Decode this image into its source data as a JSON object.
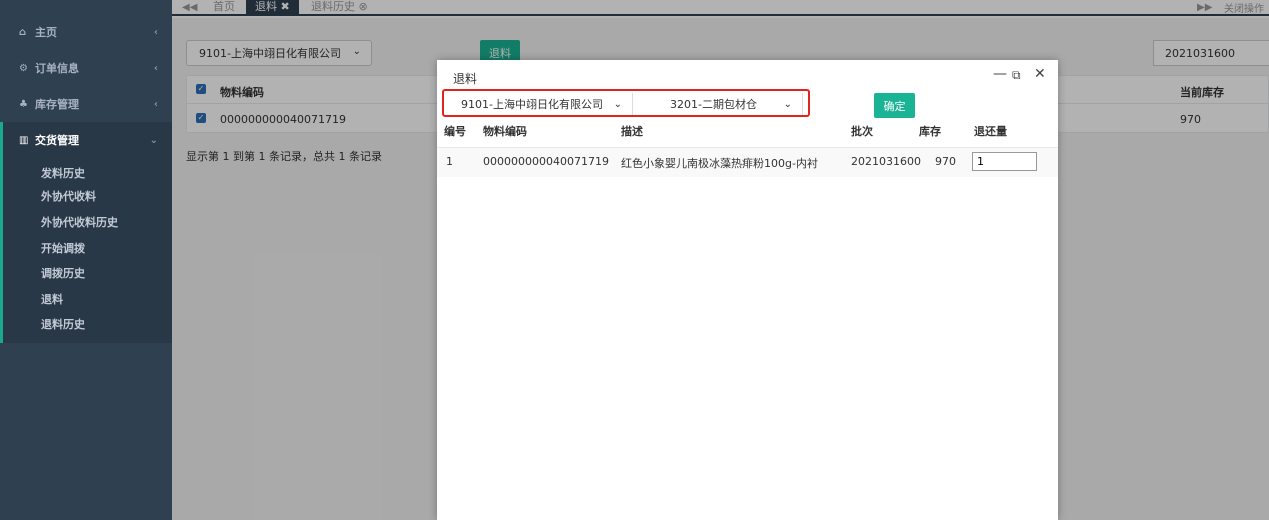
{
  "sidebar": {
    "items": [
      {
        "label": "主页",
        "icon": "home-icon"
      },
      {
        "label": "订单信息",
        "icon": "settings-icon"
      },
      {
        "label": "库存管理",
        "icon": "users-icon"
      },
      {
        "label": "交货管理",
        "icon": "chart-icon"
      }
    ],
    "submenu": [
      "发料历史",
      "外协代收料",
      "外协代收料历史",
      "开始调拨",
      "调拨历史",
      "退料",
      "退料历史"
    ]
  },
  "tabs": [
    {
      "label": "首页"
    },
    {
      "label": "退料 ✖"
    },
    {
      "label": "退料历史 ⊗"
    }
  ],
  "topbar": {
    "right_label": "关闭操作"
  },
  "background": {
    "company_select": "9101-上海中翊日化有限公司",
    "return_button": "退料",
    "date_value": "2021031600",
    "table_headers": {
      "material_code": "物料编码",
      "current_stock": "当前库存"
    },
    "row": {
      "material_code": "000000000040071719",
      "current_stock": "970"
    },
    "record_info": "显示第 1 到第 1 条记录，总共 1 条记录"
  },
  "modal": {
    "title": "退料",
    "company_select": "9101-上海中翊日化有限公司",
    "warehouse_select": "3201-二期包材仓",
    "confirm_label": "确定",
    "headers": [
      "编号",
      "物料编码",
      "描述",
      "批次",
      "库存",
      "退还量"
    ],
    "rows": [
      {
        "no": "1",
        "material_code": "000000000040071719",
        "description": "红色小象婴儿南极冰藻热痱粉100g-内衬",
        "batch": "2021031600",
        "stock": "970",
        "return_qty": "1"
      }
    ]
  }
}
